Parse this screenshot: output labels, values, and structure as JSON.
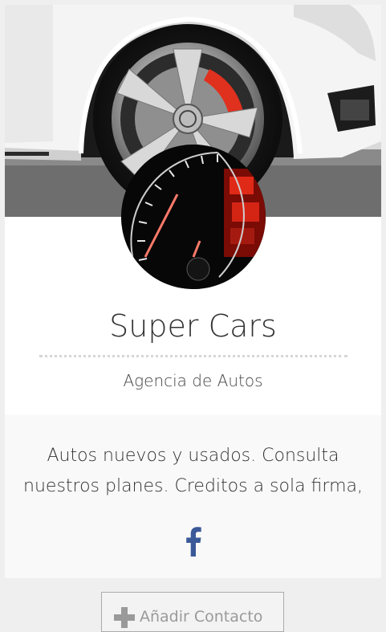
{
  "profile": {
    "name": "Super Cars",
    "subtitle": "Agencia de Autos",
    "description": "Autos nuevos y usados. Consulta nuestros planes. Creditos a sola firma,"
  },
  "social": {
    "facebook_icon": "facebook-icon"
  },
  "actions": {
    "add_contact_label": "Añadir Contacto",
    "add_contact_icon": "plus-icon"
  },
  "colors": {
    "background": "#efefef",
    "card": "#ffffff",
    "about_panel": "#f9f9f9",
    "facebook_blue": "#3b5998",
    "brake_red": "#e0301e"
  }
}
